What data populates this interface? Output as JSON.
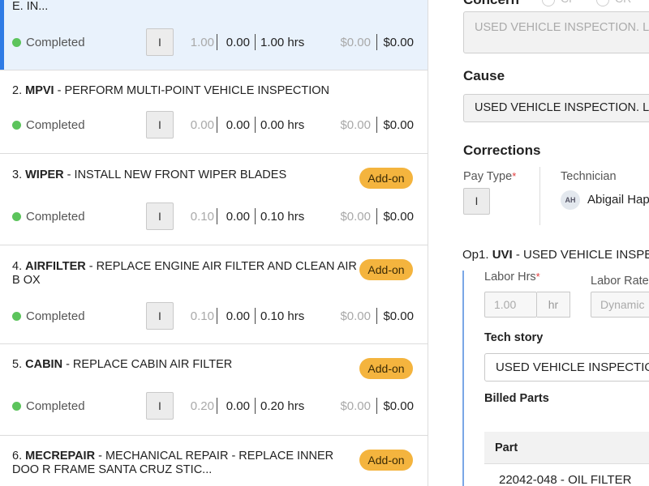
{
  "jobs": [
    {
      "number": "",
      "code": "",
      "desc": "E. IN...",
      "addon": "",
      "status": "Completed",
      "pay_type": "I",
      "hrs_a": "1.00",
      "hrs_b": "0.00",
      "hrs_c": "1.00 hrs",
      "amt_a": "$0.00",
      "amt_b": "$0.00"
    },
    {
      "number": "2.",
      "code": "MPVI",
      "desc": " - PERFORM MULTI-POINT VEHICLE INSPECTION",
      "addon": "",
      "status": "Completed",
      "pay_type": "I",
      "hrs_a": "0.00",
      "hrs_b": "0.00",
      "hrs_c": "0.00 hrs",
      "amt_a": "$0.00",
      "amt_b": "$0.00"
    },
    {
      "number": "3.",
      "code": "WIPER",
      "desc": " - INSTALL NEW FRONT WIPER BLADES",
      "addon": "Add-on",
      "status": "Completed",
      "pay_type": "I",
      "hrs_a": "0.10",
      "hrs_b": "0.00",
      "hrs_c": "0.10 hrs",
      "amt_a": "$0.00",
      "amt_b": "$0.00"
    },
    {
      "number": "4.",
      "code": "AIRFILTER",
      "desc": " - REPLACE ENGINE AIR FILTER AND CLEAN AIR B OX",
      "addon": "Add-on",
      "status": "Completed",
      "pay_type": "I",
      "hrs_a": "0.10",
      "hrs_b": "0.00",
      "hrs_c": "0.10 hrs",
      "amt_a": "$0.00",
      "amt_b": "$0.00"
    },
    {
      "number": "5.",
      "code": "CABIN",
      "desc": " - REPLACE CABIN AIR FILTER",
      "addon": "Add-on",
      "status": "Completed",
      "pay_type": "I",
      "hrs_a": "0.20",
      "hrs_b": "0.00",
      "hrs_c": "0.20 hrs",
      "amt_a": "$0.00",
      "amt_b": "$0.00"
    },
    {
      "number": "6.",
      "code": "MECREPAIR",
      "desc": " - MECHANICAL REPAIR - REPLACE INNER DOO R FRAME SANTA CRUZ STIC...",
      "addon": "Add-on",
      "status": "",
      "pay_type": "",
      "hrs_a": "",
      "hrs_b": "",
      "hrs_c": "",
      "amt_a": "",
      "amt_b": ""
    }
  ],
  "detail": {
    "concern_label": "Concern",
    "radio_a": "CP",
    "radio_b": "CR",
    "concern_value": "USED VEHICLE INSPECTION. LU",
    "cause_label": "Cause",
    "cause_value": "USED VEHICLE INSPECTION. LUB",
    "corrections_label": "Corrections",
    "pay_type_label": "Pay Type",
    "required_mark": "*",
    "pay_type_value": "I",
    "technician_label": "Technician",
    "technician_initials": "AH",
    "technician_name": "Abigail Hap",
    "op_prefix": "Op1. ",
    "op_code": "UVI",
    "op_desc": " - USED VEHICLE INSPE",
    "labor_hrs_label": "Labor Hrs",
    "labor_hrs_value": "1.00",
    "labor_hrs_unit": "hr",
    "labor_rate_label": "Labor Rate",
    "labor_rate_value": "Dynamic",
    "tech_story_label": "Tech story",
    "tech_story_value": "USED VEHICLE INSPECTION",
    "billed_parts_label": "Billed Parts",
    "parts_header": "Part",
    "part_row": "22042-048 - OIL FILTER"
  }
}
